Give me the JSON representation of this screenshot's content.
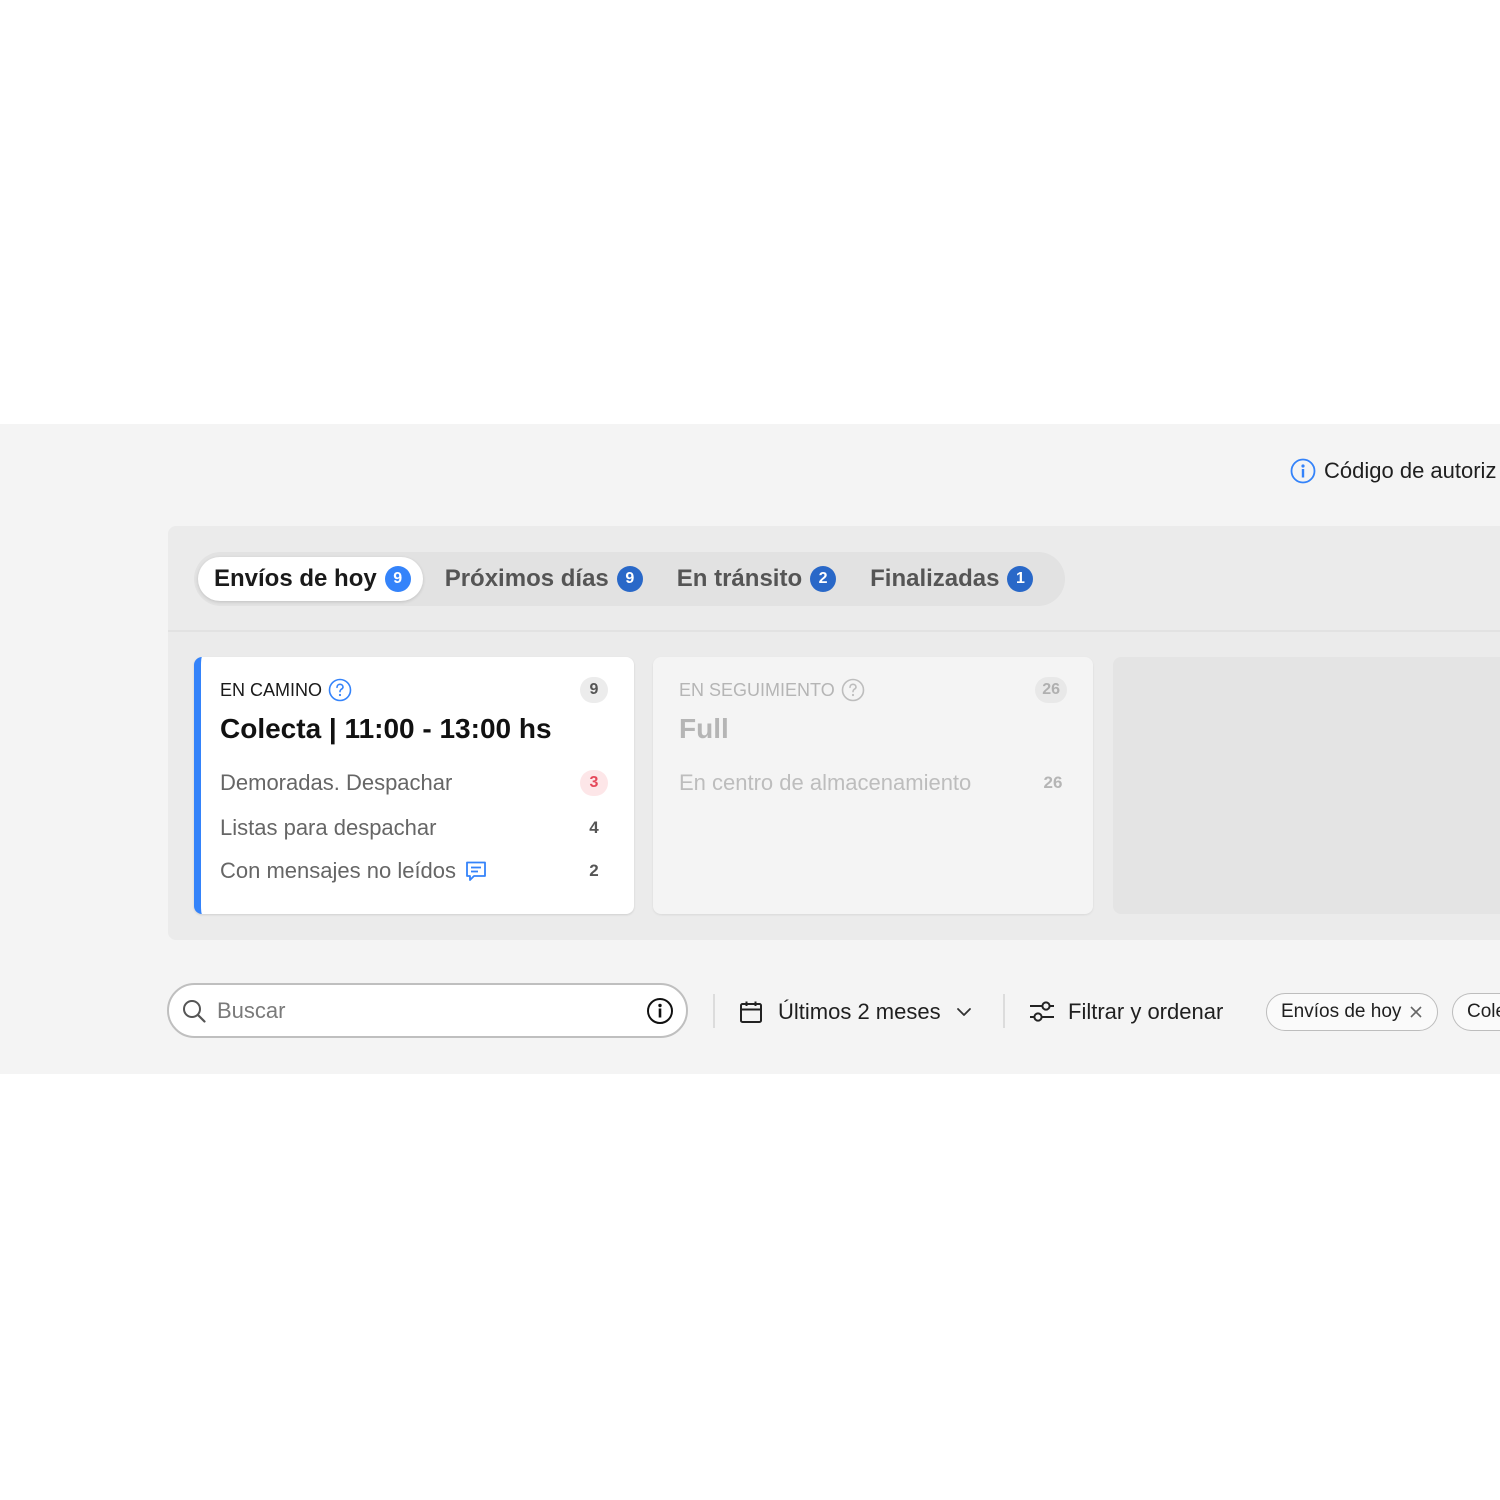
{
  "header": {
    "auth_link": "Código de autoriz",
    "auth_icon": "info-icon"
  },
  "tabs": [
    {
      "label": "Envíos de hoy",
      "count": "9",
      "active": true
    },
    {
      "label": "Próximos días",
      "count": "9",
      "active": false
    },
    {
      "label": "En tránsito",
      "count": "2",
      "active": false
    },
    {
      "label": "Finalizadas",
      "count": "1",
      "active": false
    }
  ],
  "cards": [
    {
      "status": "EN CAMINO",
      "total": "9",
      "title": "Colecta | 11:00 - 13:00 hs",
      "accent": "#3483fa",
      "rows": [
        {
          "label": "Demoradas. Despachar",
          "count": "3",
          "alert": true
        },
        {
          "label": "Listas para despachar",
          "count": "4"
        },
        {
          "label": "Con mensajes no leídos",
          "count": "2",
          "icon": "chat-icon"
        }
      ]
    },
    {
      "status": "EN SEGUIMIENTO",
      "total": "26",
      "title": "Full",
      "rows": [
        {
          "label": "En centro de almacenamiento",
          "count": "26"
        }
      ]
    }
  ],
  "toolbar": {
    "search_placeholder": "Buscar",
    "period_label": "Últimos 2 meses",
    "filter_label": "Filtrar y ordenar",
    "chips": [
      "Envíos de hoy",
      "Cole"
    ]
  },
  "colors": {
    "accent": "#3483fa",
    "badge_blue": "#2968c8",
    "alert_red": "#e5485a"
  }
}
